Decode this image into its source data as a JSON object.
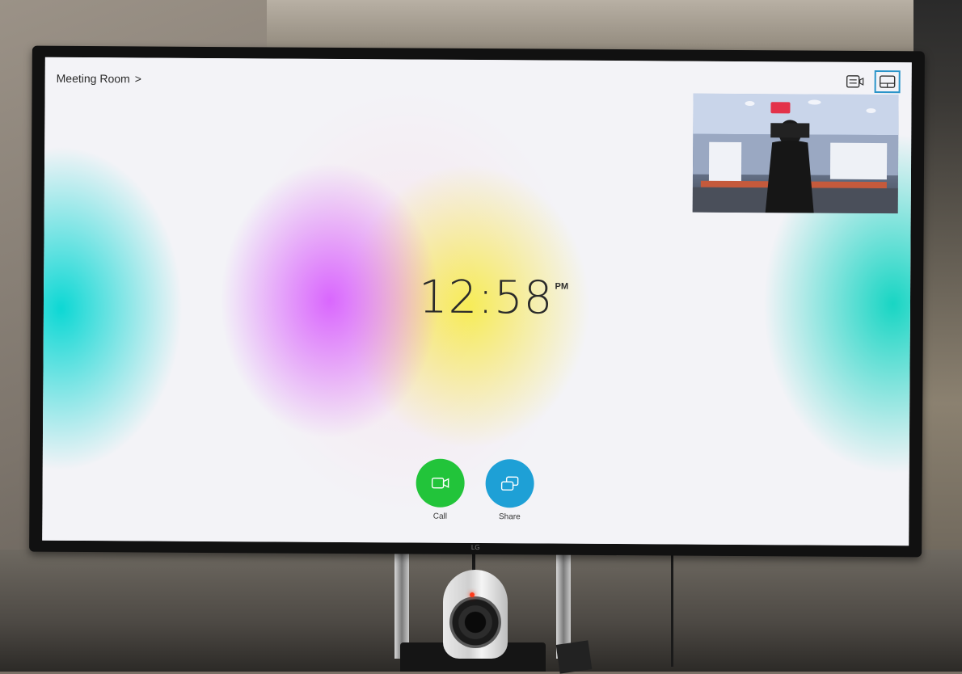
{
  "device": {
    "breadcrumb": {
      "label": "Meeting Room",
      "chevron": ">"
    },
    "clock": {
      "time": "12:58",
      "ampm": "PM"
    },
    "top_icons": [
      "layout-list-icon",
      "layout-pip-icon"
    ],
    "actions": [
      {
        "label": "Call",
        "icon": "video-camera-icon",
        "color": "#22c43a"
      },
      {
        "label": "Share",
        "icon": "share-screen-icon",
        "color": "#1ea0d6"
      }
    ],
    "tv_brand": "LG"
  },
  "colors": {
    "accent_active_border": "#2a94c9",
    "call_green": "#22c43a",
    "share_blue": "#1ea0d6"
  }
}
